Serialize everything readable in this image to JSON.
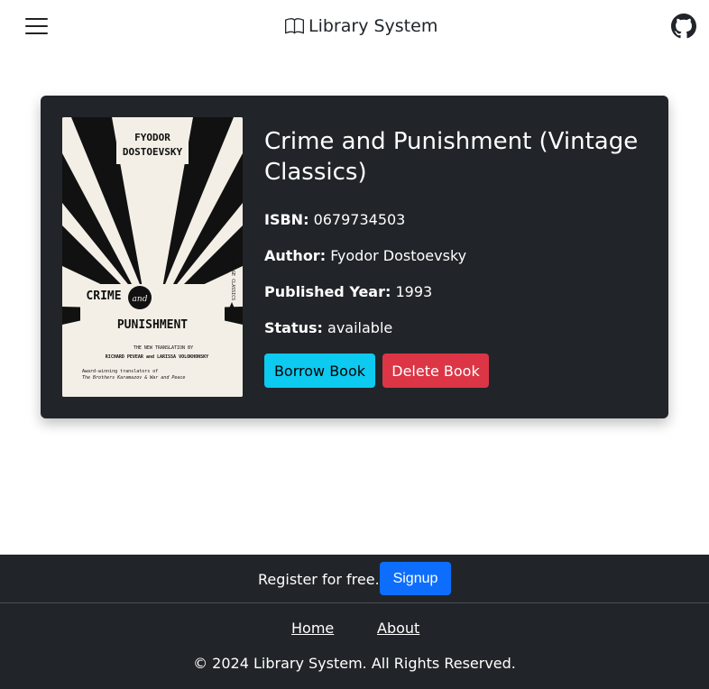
{
  "header": {
    "brand_label": "Library System",
    "menu_icon": "hamburger-menu-icon",
    "brand_icon": "open-book-icon",
    "github_icon": "github-icon"
  },
  "book": {
    "title": "Crime and Punishment (Vintage Classics)",
    "isbn_label": "ISBN:",
    "isbn": "0679734503",
    "author_label": "Author:",
    "author": "Fyodor Dostoevsky",
    "year_label": "Published Year:",
    "year": "1993",
    "status_label": "Status:",
    "status": "available",
    "borrow_label": "Borrow Book",
    "delete_label": "Delete Book",
    "cover": {
      "author_line1": "FYODOR",
      "author_line2": "DOSTOEVSKY",
      "title_line1": "CRIME",
      "title_and": "and",
      "title_line2": "PUNISHMENT",
      "translation_line1": "THE NEW TRANSLATION BY",
      "translation_line2": "RICHARD PEVEAR and LARISSA VOLOKHONSKY",
      "award_line1": "Award-winning translators of",
      "award_line2": "The Brothers Karamazov & War and Peace",
      "spine_text": "VINTAGE CLASSICS"
    }
  },
  "footer": {
    "register_text": "Register for free.",
    "signup_label": "Signup",
    "links": [
      "Home",
      "About"
    ],
    "copyright": "© 2024 Library System. All Rights Reserved."
  },
  "colors": {
    "card_bg": "#212529",
    "borrow_btn": "#0dcaf0",
    "delete_btn": "#dc3545",
    "signup_btn": "#0d6efd"
  }
}
